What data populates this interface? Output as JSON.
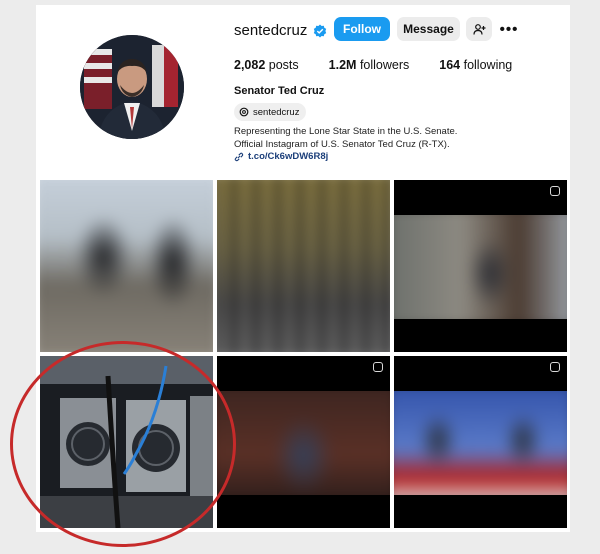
{
  "profile": {
    "username": "sentedcruz",
    "verified": true,
    "follow_label": "Follow",
    "message_label": "Message",
    "add_user_icon": "person-plus-icon",
    "more_icon": "more-icon",
    "more_glyph": "•••",
    "posts_count": "2,082",
    "posts_label": "posts",
    "followers_count": "1.2M",
    "followers_label": "followers",
    "following_count": "164",
    "following_label": "following",
    "full_name": "Senator Ted Cruz",
    "threads_handle": "sentedcruz",
    "bio_line1": "Representing the Lone Star State in the U.S. Senate.",
    "bio_line2": "Official Instagram of U.S. Senator Ted Cruz (R-TX).",
    "link": "t.co/Ck6wDW6R8j"
  },
  "posts": [
    {
      "subject": "two people outdoors"
    },
    {
      "subject": "group of people"
    },
    {
      "subject": "man outdoors video"
    },
    {
      "subject": "crypto mining rigs"
    },
    {
      "subject": "man speaking video"
    },
    {
      "subject": "news broadcast video"
    }
  ],
  "colors": {
    "follow": "#1a9bf0",
    "highlight_circle": "#c62a2a",
    "verified": "#1a9bf0"
  }
}
